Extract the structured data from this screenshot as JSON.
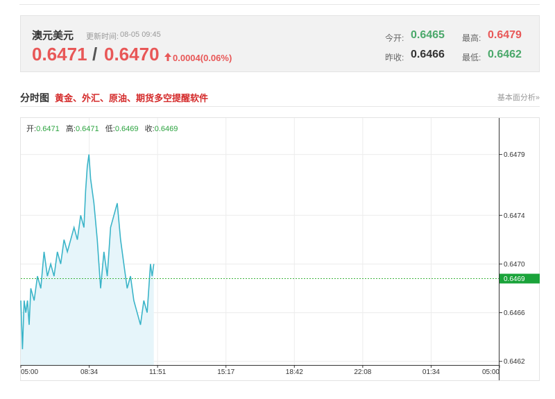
{
  "quote": {
    "pair_name": "澳元美元",
    "update_label": "更新时间:",
    "update_time": "08-05 09:45",
    "bid": "0.6471",
    "separator": "/",
    "ask": "0.6470",
    "change": "0.0004(0.06%)",
    "open_label": "今开:",
    "open_value": "0.6465",
    "high_label": "最高:",
    "high_value": "0.6479",
    "prev_close_label": "昨收:",
    "prev_close_value": "0.6466",
    "low_label": "最低:",
    "low_value": "0.6462"
  },
  "section": {
    "title": "分时图",
    "promo": "黄金、外汇、原油、期货多空提醒软件",
    "analysis_link": "基本面分析»"
  },
  "ohlc": {
    "open_label": "开:",
    "open_value": "0.6471",
    "high_label": "高:",
    "high_value": "0.6471",
    "low_label": "低:",
    "low_value": "0.6469",
    "close_label": "收:",
    "close_value": "0.6469"
  },
  "colors": {
    "price_red": "#e85757",
    "value_green": "#4aa86a",
    "line": "#3ab4c8",
    "fill": "#e6f5fa",
    "current_tag": "#1aa33a",
    "reference_line": "#3cb33c"
  },
  "chart_data": {
    "type": "area",
    "title": "",
    "xlabel": "",
    "ylabel": "",
    "x_ticks": [
      "05:00",
      "08:34",
      "11:51",
      "15:17",
      "18:42",
      "22:08",
      "01:34",
      "05:00"
    ],
    "y_ticks": [
      "0.6479",
      "0.6474",
      "0.6470",
      "0.6466",
      "0.6462"
    ],
    "y_tick_values": [
      0.6479,
      0.6474,
      0.647,
      0.6466,
      0.6462
    ],
    "ylim": [
      0.64617,
      0.6482
    ],
    "current_price": "0.6469",
    "current_value": 0.64688,
    "grid": true,
    "series": [
      {
        "x": [
          "05:00",
          "05:05",
          "05:10",
          "05:15",
          "05:20",
          "05:25",
          "05:30",
          "05:40",
          "05:50",
          "06:00",
          "06:10",
          "06:20",
          "06:30",
          "06:40",
          "06:50",
          "07:00",
          "07:10",
          "07:20",
          "07:30",
          "07:40",
          "07:50",
          "08:00",
          "08:10",
          "08:15",
          "08:20",
          "08:25",
          "08:30",
          "08:40",
          "08:50",
          "09:00",
          "09:10",
          "09:20",
          "09:30",
          "09:40",
          "09:50",
          "10:00",
          "10:10",
          "10:20",
          "10:30",
          "10:40",
          "10:50",
          "11:00",
          "11:10",
          "11:20",
          "11:25",
          "11:30",
          "11:35",
          "11:40"
        ],
        "values": [
          0.6467,
          0.6463,
          0.6467,
          0.6466,
          0.6467,
          0.6465,
          0.6468,
          0.6467,
          0.6469,
          0.6468,
          0.6471,
          0.6469,
          0.647,
          0.6469,
          0.6471,
          0.647,
          0.6472,
          0.6471,
          0.6472,
          0.6473,
          0.6472,
          0.6474,
          0.6473,
          0.6476,
          0.6478,
          0.6479,
          0.6477,
          0.6475,
          0.6472,
          0.6468,
          0.6471,
          0.6469,
          0.6473,
          0.6474,
          0.6475,
          0.6472,
          0.647,
          0.6468,
          0.6469,
          0.6467,
          0.6466,
          0.6465,
          0.6467,
          0.6466,
          0.6468,
          0.647,
          0.6469,
          0.647
        ]
      }
    ]
  }
}
